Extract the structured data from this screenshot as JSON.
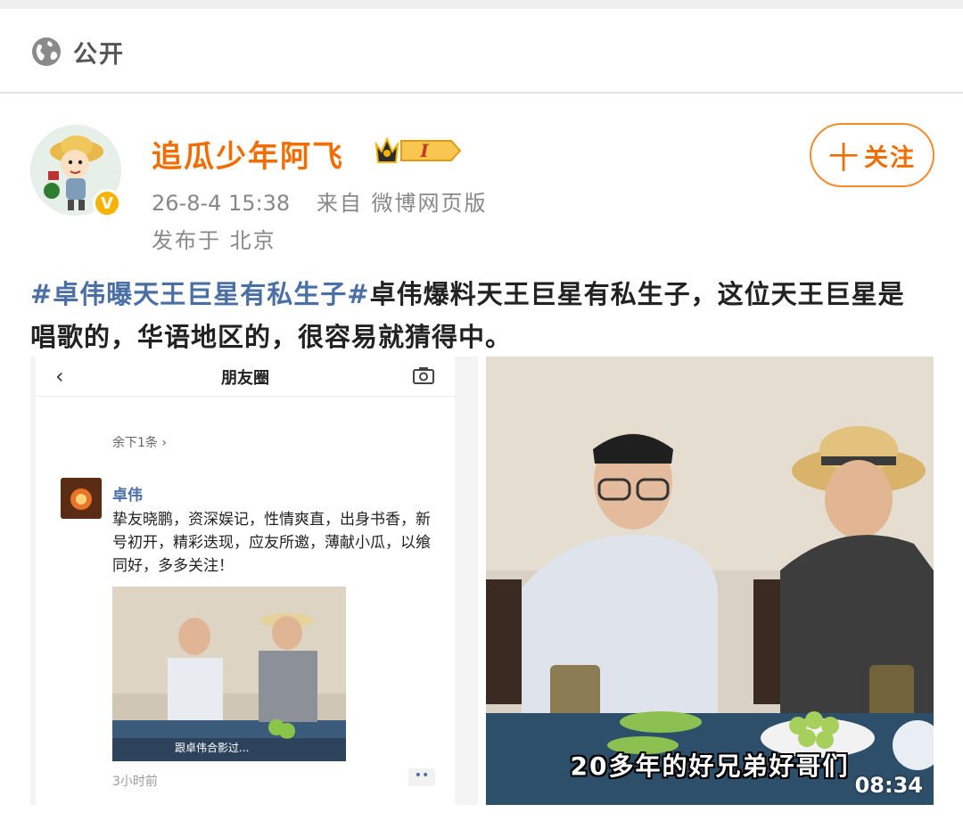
{
  "visibility": {
    "label": "公开",
    "icon": "globe-icon"
  },
  "author": {
    "name": "追瓜少年阿飞",
    "verified_icon": "verified-v-icon",
    "verified_text": "V",
    "level_badge_text": "I",
    "post_time": "26-8-4 15:38",
    "source": "来自 微博网页版",
    "location": "发布于 北京"
  },
  "follow_button": {
    "plus": "十",
    "label": "关注"
  },
  "post": {
    "hashtag": "#卓伟曝天王巨星有私生子#",
    "body": "卓伟爆料天王巨星有私生子，这位天王巨星是唱歌的，华语地区的，很容易就猜得中。"
  },
  "image_left": {
    "header_back": "‹",
    "header_title": "朋友圈",
    "more_replies": "余下1条 ›",
    "author": "卓伟",
    "text": "挚友晓鹏，资深娱记，性情爽直，出身书香，新号初开，精彩迭现，应友所邀，薄献小瓜，以飨同好，多多关注！",
    "photo_caption": "跟卓伟合影过...",
    "time": "3小时前",
    "dots": "••"
  },
  "image_right": {
    "subtitle": "20多年的好兄弟好哥们",
    "duration": "08:34"
  },
  "colors": {
    "username": "#f26d00",
    "hashtag": "#4a6fa5",
    "follow_border": "#f58a2a",
    "verified": "#f6b400"
  }
}
